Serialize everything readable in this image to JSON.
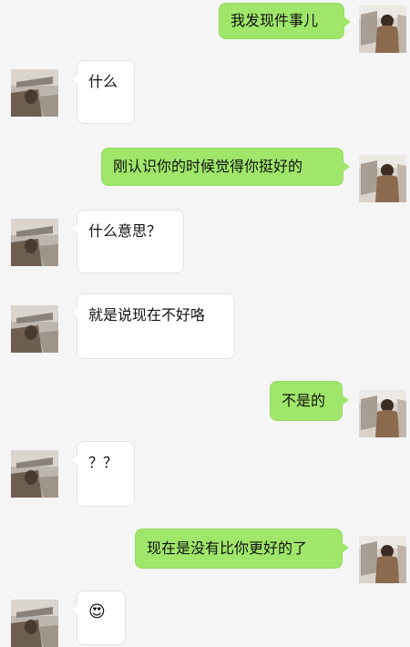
{
  "messages": [
    {
      "side": "right",
      "text": "我发现件事儿"
    },
    {
      "side": "left",
      "text": "什么"
    },
    {
      "side": "right",
      "text": "刚认识你的时候觉得你挺好的"
    },
    {
      "side": "left",
      "text": "什么意思？"
    },
    {
      "side": "left",
      "text": "就是说现在不好咯"
    },
    {
      "side": "right",
      "text": "不是的"
    },
    {
      "side": "left",
      "text": "？？"
    },
    {
      "side": "right",
      "text": "现在是没有比你更好的了"
    },
    {
      "side": "left",
      "text": "😍"
    }
  ],
  "colors": {
    "sent_bubble": "#9fe66a",
    "received_bubble": "#ffffff",
    "background": "#f5f5f5"
  }
}
